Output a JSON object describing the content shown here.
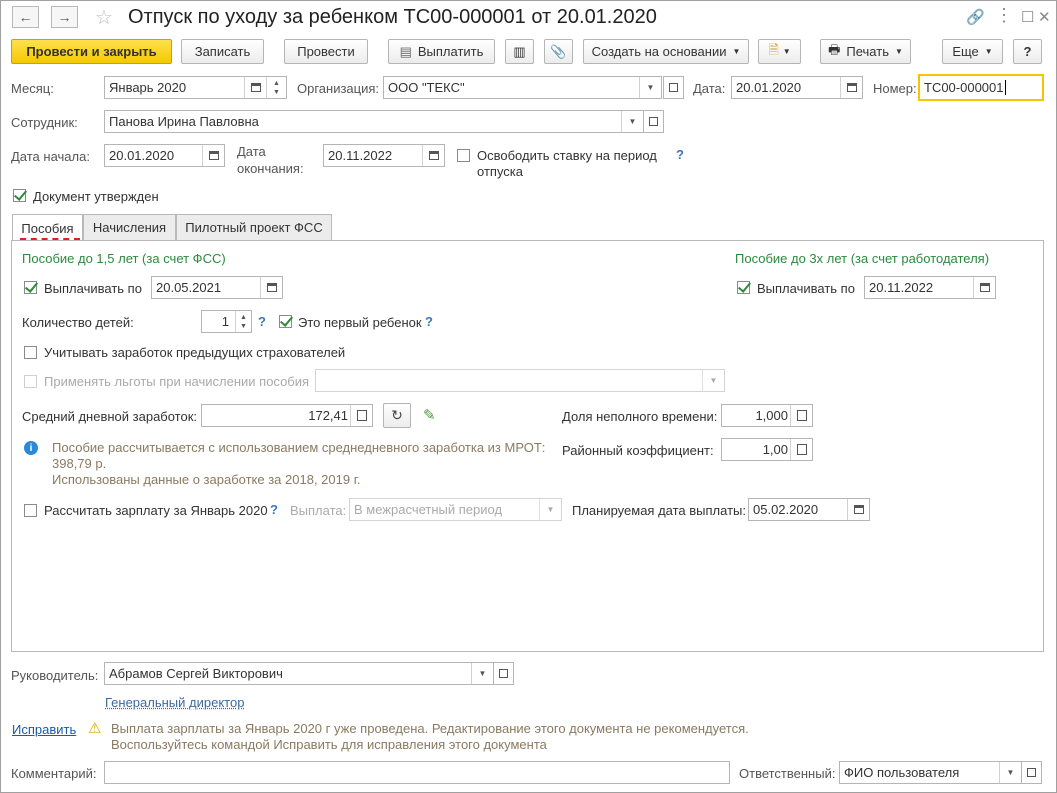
{
  "header": {
    "title": "Отпуск по уходу за ребенком ТС00-000001 от 20.01.2020"
  },
  "toolbar": {
    "post_close": "Провести и закрыть",
    "save": "Записать",
    "post": "Провести",
    "pay": "Выплатить",
    "create_based": "Создать на основании",
    "print": "Печать",
    "more": "Еще",
    "help": "?"
  },
  "form": {
    "month_label": "Месяц:",
    "month_value": "Январь 2020",
    "org_label": "Организация:",
    "org_value": "ООО \"ТЕКС\"",
    "date_label": "Дата:",
    "date_value": "20.01.2020",
    "number_label": "Номер:",
    "number_value": "ТС00-000001",
    "employee_label": "Сотрудник:",
    "employee_value": "Панова Ирина Павловна",
    "start_label": "Дата начала:",
    "start_value": "20.01.2020",
    "end_label_1": "Дата",
    "end_label_2": "окончания:",
    "end_value": "20.11.2022",
    "free_rate_label_1": "Освободить ставку на период",
    "free_rate_label_2": "отпуска",
    "approved_label": "Документ утвержден"
  },
  "tabs": [
    "Пособия",
    "Начисления",
    "Пилотный проект ФСС"
  ],
  "benefits": {
    "fss_heading": "Пособие до 1,5 лет (за счет ФСС)",
    "employer_heading": "Пособие до 3х лет (за счет работодателя)",
    "pay_until_label": "Выплачивать по",
    "pay_until_value": "20.05.2021",
    "pay_until_value2": "20.11.2022",
    "children_label": "Количество детей:",
    "children_value": "1",
    "first_child_label": "Это первый ребенок",
    "prev_insurers_label": "Учитывать заработок предыдущих страхователей",
    "privileges_label": "Применять льготы при начислении пособия",
    "avg_earnings_label": "Средний дневной заработок:",
    "avg_earnings_value": "172,41",
    "part_time_label": "Доля неполного времени:",
    "part_time_value": "1,000",
    "regional_label": "Районный коэффициент:",
    "regional_value": "1,00",
    "info_line1": "Пособие рассчитывается с использованием среднедневного заработка из МРОТ:",
    "info_line2": "398,79 р.",
    "info_line3": "Использованы данные о заработке за  2018,  2019 г.",
    "calc_salary_label": "Рассчитать зарплату за Январь 2020",
    "payout_label": "Выплата:",
    "payout_value": "В межрасчетный период",
    "planned_date_label": "Планируемая дата выплаты:",
    "planned_date_value": "05.02.2020"
  },
  "footer": {
    "manager_label": "Руководитель:",
    "manager_value": "Абрамов Сергей Викторович",
    "manager_position": "Генеральный директор",
    "fix_link": "Исправить",
    "warning_line1": "Выплата зарплаты за Январь 2020 г уже проведена. Редактирование этого документа не рекомендуется.",
    "warning_line2": "Воспользуйтесь командой Исправить для исправления этого документа",
    "comment_label": "Комментарий:",
    "comment_value": "",
    "responsible_label": "Ответственный:",
    "responsible_value": "ФИО пользователя"
  },
  "colors": {
    "accent": "#f4c800",
    "green": "#2b8a3e",
    "link": "#1a5aa8"
  }
}
